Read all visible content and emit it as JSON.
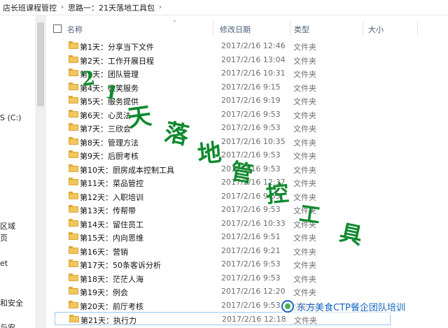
{
  "breadcrumb": {
    "items": [
      "店长班课程管控",
      "思路一：21天落地工具包"
    ]
  },
  "nav": {
    "items": [
      "S (C:)",
      "区域",
      "页",
      "et",
      "和安全",
      "与安"
    ]
  },
  "columns": {
    "name": "名称",
    "date": "修改日期",
    "type": "类型",
    "size": "大小"
  },
  "files": [
    {
      "name": "第1天：分享当下文件",
      "date": "2017/2/16 12:46",
      "type": "文件夹"
    },
    {
      "name": "第2天：工作开展日程",
      "date": "2017/2/16 13:04",
      "type": "文件夹"
    },
    {
      "name": "第3天：团队管理",
      "date": "2017/2/16 10:31",
      "type": "文件夹"
    },
    {
      "name": "第4天：微笑服务",
      "date": "2017/2/16 9:15",
      "type": "文件夹"
    },
    {
      "name": "第5天：服务提供",
      "date": "2017/2/16 9:19",
      "type": "文件夹"
    },
    {
      "name": "第6天：心灵法",
      "date": "2017/2/16 9:53",
      "type": "文件夹"
    },
    {
      "name": "第7天：三欣会",
      "date": "2017/2/16 9:53",
      "type": "文件夹"
    },
    {
      "name": "第8天：管理方法",
      "date": "2017/2/16 10:35",
      "type": "文件夹"
    },
    {
      "name": "第9天：后厨考核",
      "date": "2017/2/16 9:53",
      "type": "文件夹"
    },
    {
      "name": "第10天：厨房成本控制工具",
      "date": "2017/2/16 9:53",
      "type": "文件夹"
    },
    {
      "name": "第11天：菜品管控",
      "date": "2017/2/16 12:37",
      "type": "文件夹"
    },
    {
      "name": "第12天：入职培训",
      "date": "2017/2/16 9:53",
      "type": "文件夹"
    },
    {
      "name": "第13天：传帮带",
      "date": "2017/2/16 9:53",
      "type": "文件夹"
    },
    {
      "name": "第14天：留住员工",
      "date": "2017/2/16 10:33",
      "type": "文件夹"
    },
    {
      "name": "第15天：内向思维",
      "date": "2017/2/16 9:51",
      "type": "文件夹"
    },
    {
      "name": "第16天：营销",
      "date": "2017/2/16 9:21",
      "type": "文件夹"
    },
    {
      "name": "第17天：50条客诉分析",
      "date": "2017/2/16 9:53",
      "type": "文件夹"
    },
    {
      "name": "第18天：茫茫人海",
      "date": "2017/2/16 9:53",
      "type": "文件夹"
    },
    {
      "name": "第19天：例会",
      "date": "2017/2/16 12:20",
      "type": "文件夹"
    },
    {
      "name": "第20天：前厅考核",
      "date": "2017/2/16 9:53",
      "type": "文件夹"
    },
    {
      "name": "第21天：执行力",
      "date": "2017/2/16 12:18",
      "type": "文件夹"
    }
  ],
  "overlay_text": {
    "chars": [
      "2",
      "1",
      "天",
      "落",
      "地",
      "管",
      "控",
      "工",
      "具"
    ],
    "color": "#0f8a2e"
  },
  "watermark": {
    "text": "东方美食CTP餐企团队培训",
    "color": "#1565c0"
  },
  "selection_color": "#99c9ef"
}
